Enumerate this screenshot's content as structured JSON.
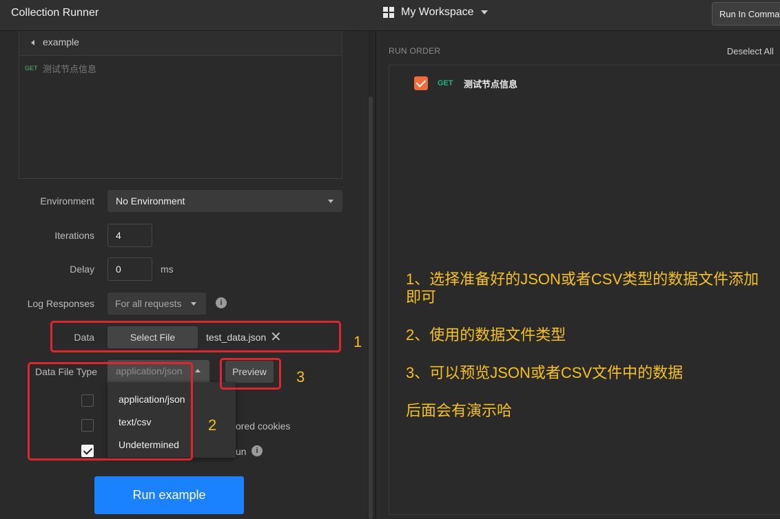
{
  "header": {
    "app_title": "Collection Runner",
    "workspace": "My Workspace",
    "run_in_command_line": "Run In Comma"
  },
  "collection": {
    "folder": "example",
    "requests": [
      {
        "method": "GET",
        "name": "测试节点信息"
      }
    ]
  },
  "settings": {
    "environment_label": "Environment",
    "environment_value": "No Environment",
    "iterations_label": "Iterations",
    "iterations_value": "4",
    "delay_label": "Delay",
    "delay_value": "0",
    "delay_unit": "ms",
    "log_responses_label": "Log Responses",
    "log_responses_value": "For all requests",
    "data_label": "Data",
    "select_file_label": "Select File",
    "data_file_name": "test_data.json",
    "data_file_type_label": "Data File Type",
    "data_file_type_value": "application/json",
    "preview_label": "Preview",
    "data_file_type_options": [
      "application/json",
      "text/csv",
      "Undetermined"
    ],
    "checkboxes": [
      {
        "partial_label": "",
        "checked": false
      },
      {
        "partial_label": "ored cookies",
        "checked": false
      },
      {
        "partial_label": "un",
        "checked": true
      }
    ],
    "run_button": "Run example"
  },
  "run_order": {
    "title": "RUN ORDER",
    "deselect_all": "Deselect All",
    "items": [
      {
        "method": "GET",
        "name": "测试节点信息",
        "checked": true
      }
    ]
  },
  "annotations": {
    "markers": [
      "1",
      "2",
      "3"
    ],
    "notes": [
      "1、选择准备好的JSON或者CSV类型的数据文件添加即可",
      "2、使用的数据文件类型",
      "3、可以预览JSON或者CSV文件中的数据",
      "后面会有演示哈"
    ],
    "color": "#f5c218",
    "box_color": "#e0262c"
  }
}
